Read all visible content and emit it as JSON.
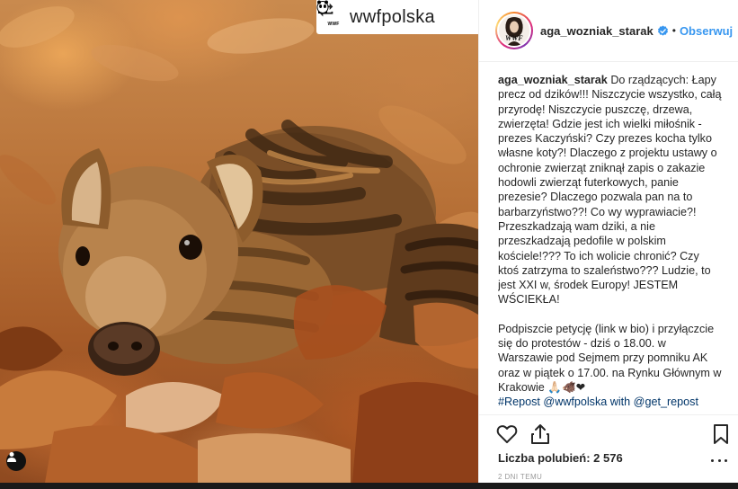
{
  "repost": {
    "handle": "wwfpolska",
    "logo_text": "WWF",
    "icon": "repost-icon"
  },
  "post_header": {
    "username": "aga_wozniak_starak",
    "separator": "•",
    "follow_label": "Obserwuj",
    "avatar_badge": "WWF",
    "accent_color": "#3897f0"
  },
  "caption": {
    "username": "aga_wozniak_starak",
    "text_1": "Do rządzących: Łapy precz od dzików!!! Niszczycie wszystko, całą przyrodę! Niszczycie puszczę, drzewa, zwierzęta! Gdzie jest ich wielki miłośnik - prezes Kaczyński? Czy prezes kocha tylko własne koty?! Dlaczego z projektu ustawy o ochronie zwierząt zniknął zapis o zakazie hodowli zwierząt futerkowych, panie prezesie? Dlaczego pozwala pan na to barbarzyństwo??! Co wy wyprawiacie?! Przeszkadzają wam dziki, a nie przeszkadzają pedofile w polskim kościele!??? To ich wolicie chronić? Czy ktoś zatrzyma to szaleństwo??? Ludzie, to jest XXI w, środek Europy! JESTEM WŚCIEKŁA!",
    "text_2": "Podpiszcie petycję (link w bio) i przyłączcie się do protestów - dziś o 18.00. w Warszawie pod Sejmem przy pomniku AK oraz w piątek o 17.00. na Rynku Głównym w Krakowie 🙏🏻🐗❤",
    "hashtags": "#Repost @wwfpolska with @get_repost"
  },
  "actions": {
    "like_icon": "heart-icon",
    "share_icon": "share-icon",
    "save_icon": "bookmark-icon",
    "more_icon": "more-icon",
    "likes_text": "Liczba polubień: 2 576",
    "timestamp": "2 DNI TEMU"
  },
  "photo": {
    "description_icon": "user-tag-icon"
  }
}
